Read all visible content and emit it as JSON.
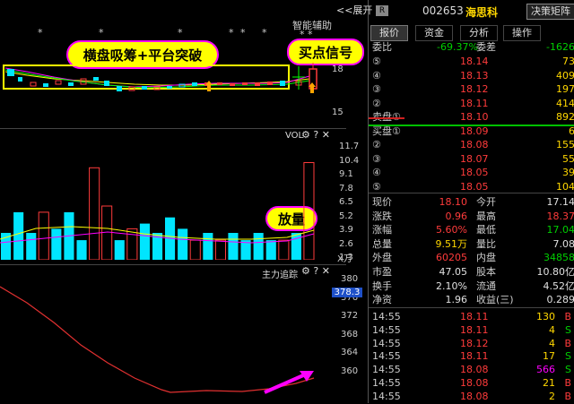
{
  "header": {
    "expand_label": "<<展开",
    "tag": "R",
    "code": "002653",
    "name": "海思科",
    "strategy_button": "决策矩阵"
  },
  "tabs": [
    "报价",
    "资金",
    "分析",
    "操作"
  ],
  "top_chart": {
    "smart_assist": "智能辅助",
    "stars": "*  *",
    "annotation_consolidation": "横盘吸筹+平台突破",
    "annotation_buy": "买点信号",
    "axis_ticks": [
      "18",
      "15"
    ]
  },
  "volume_chart": {
    "title": "VOL",
    "annotation_volume": "放量",
    "axis_ticks": [
      "11.7",
      "10.4",
      "9.1",
      "7.8",
      "6.5",
      "5.2",
      "3.9",
      "2.6",
      "1.3"
    ],
    "unit": "X万"
  },
  "capital_chart": {
    "title": "主力追踪",
    "axis_ticks": [
      "380",
      "376",
      "372",
      "368",
      "364",
      "360"
    ],
    "current_badge": "378.3"
  },
  "order_book": {
    "ratio_label": "委比",
    "ratio_value": "-69.37%",
    "diff_label": "委差",
    "diff_value": "-1626",
    "sells": [
      {
        "label": "⑤",
        "price": "18.14",
        "vol": "73"
      },
      {
        "label": "④",
        "price": "18.13",
        "vol": "409"
      },
      {
        "label": "③",
        "price": "18.12",
        "vol": "197"
      },
      {
        "label": "②",
        "price": "18.11",
        "vol": "414"
      },
      {
        "label": "卖盘①",
        "price": "18.10",
        "vol": "892"
      }
    ],
    "buys": [
      {
        "label": "买盘①",
        "price": "18.09",
        "vol": "6"
      },
      {
        "label": "②",
        "price": "18.08",
        "vol": "155"
      },
      {
        "label": "③",
        "price": "18.07",
        "vol": "55"
      },
      {
        "label": "④",
        "price": "18.05",
        "vol": "39"
      },
      {
        "label": "⑤",
        "price": "18.05",
        "vol": "104"
      }
    ]
  },
  "stats": [
    {
      "l1": "现价",
      "v1": "18.10",
      "c1": "red",
      "l2": "今开",
      "v2": "17.14",
      "c2": "white"
    },
    {
      "l1": "涨跌",
      "v1": "0.96",
      "c1": "red",
      "l2": "最高",
      "v2": "18.37",
      "c2": "red"
    },
    {
      "l1": "涨幅",
      "v1": "5.60%",
      "c1": "red",
      "l2": "最低",
      "v2": "17.04",
      "c2": "green"
    },
    {
      "l1": "总量",
      "v1": "9.51万",
      "c1": "yellow",
      "l2": "量比",
      "v2": "7.08",
      "c2": "white"
    },
    {
      "l1": "外盘",
      "v1": "60205",
      "c1": "red",
      "l2": "内盘",
      "v2": "34858",
      "c2": "green"
    },
    {
      "l1": "市盈",
      "v1": "47.05",
      "c1": "white",
      "l2": "股本",
      "v2": "10.80亿",
      "c2": "white"
    },
    {
      "l1": "换手",
      "v1": "2.10%",
      "c1": "white",
      "l2": "流通",
      "v2": "4.52亿",
      "c2": "white"
    },
    {
      "l1": "净资",
      "v1": "1.96",
      "c1": "white",
      "l2": "收益(三)",
      "v2": "0.289",
      "c2": "white"
    }
  ],
  "ticks": [
    {
      "time": "14:55",
      "price": "18.11",
      "vol": "130",
      "side": "B"
    },
    {
      "time": "14:55",
      "price": "18.11",
      "vol": "4",
      "side": "S"
    },
    {
      "time": "14:55",
      "price": "18.12",
      "vol": "4",
      "side": "B"
    },
    {
      "time": "14:55",
      "price": "18.11",
      "vol": "17",
      "side": "S"
    },
    {
      "time": "14:55",
      "price": "18.08",
      "vol": "566",
      "side": "S"
    },
    {
      "time": "14:55",
      "price": "18.08",
      "vol": "21",
      "side": "B"
    },
    {
      "time": "14:55",
      "price": "18.08",
      "vol": "2",
      "side": "B"
    }
  ],
  "chart_data": {
    "type": "bar",
    "volume_values": [
      2.6,
      4.6,
      2.6,
      4.6,
      3.0,
      4.6,
      1.9,
      8.9,
      5.2,
      1.9,
      3.0,
      3.5,
      2.6,
      4.1,
      3.0,
      1.9,
      2.6,
      1.9,
      2.6,
      1.9,
      2.6,
      1.9,
      1.9,
      2.6,
      9.4
    ],
    "volume_colors": [
      "cyan",
      "cyan",
      "cyan",
      "red",
      "cyan",
      "cyan",
      "cyan",
      "red",
      "red",
      "cyan",
      "red",
      "cyan",
      "cyan",
      "cyan",
      "cyan",
      "red",
      "cyan",
      "red",
      "cyan",
      "cyan",
      "cyan",
      "cyan",
      "red",
      "cyan",
      "red"
    ],
    "volume_ylim": [
      0,
      11.7
    ],
    "capital_ylim": [
      360,
      380
    ]
  }
}
